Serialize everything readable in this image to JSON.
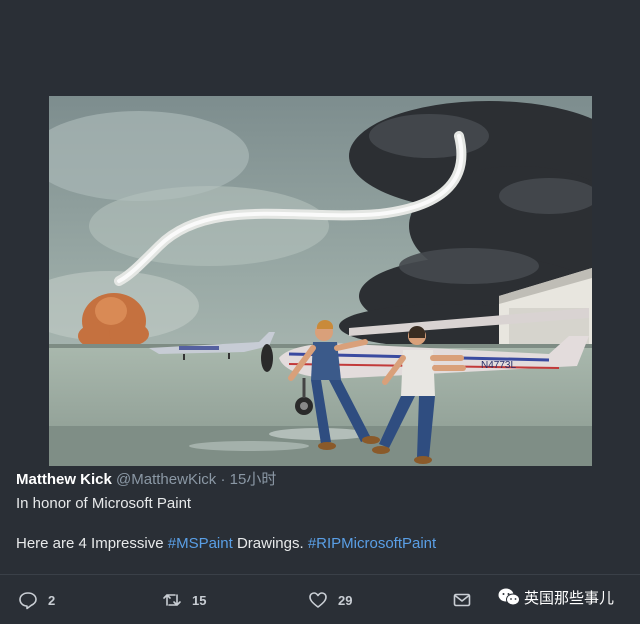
{
  "tweet": {
    "author_name": "Matthew Kick",
    "author_handle": "@MatthewKick",
    "separator": "·",
    "time": "15小时",
    "line1": "In honor of Microsoft Paint",
    "line2_prefix": "Here are 4 Impressive ",
    "hashtag1": "#MSPaint",
    "line2_middle": " Drawings. ",
    "hashtag2": "#RIPMicrosoftPaint"
  },
  "media": {
    "plane_registration": "N4773L"
  },
  "actions": {
    "reply_count": "2",
    "retweet_count": "15",
    "like_count": "29"
  },
  "watermark": {
    "text": "英国那些事儿"
  },
  "icons": {
    "reply": "reply-icon",
    "retweet": "retweet-icon",
    "like": "heart-icon",
    "message": "message-icon",
    "watermark": "wechat-icon"
  }
}
